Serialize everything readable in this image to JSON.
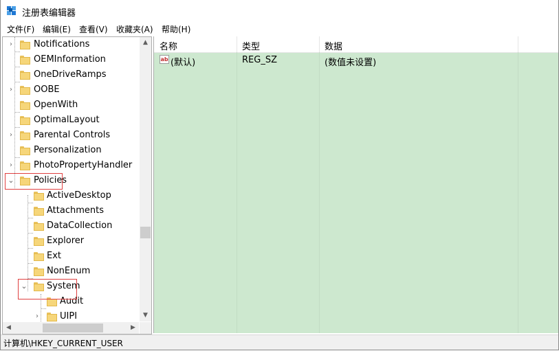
{
  "window": {
    "title": "注册表编辑器",
    "accent": "#1e78d4"
  },
  "menu": [
    {
      "label": "文件(F)"
    },
    {
      "label": "编辑(E)"
    },
    {
      "label": "查看(V)"
    },
    {
      "label": "收藏夹(A)"
    },
    {
      "label": "帮助(H)"
    }
  ],
  "tree": {
    "nodes": [
      {
        "label": "Notifications",
        "expander": "collapsed"
      },
      {
        "label": "OEMInformation",
        "expander": "none"
      },
      {
        "label": "OneDriveRamps",
        "expander": "none"
      },
      {
        "label": "OOBE",
        "expander": "collapsed"
      },
      {
        "label": "OpenWith",
        "expander": "none"
      },
      {
        "label": "OptimalLayout",
        "expander": "none"
      },
      {
        "label": "Parental Controls",
        "expander": "collapsed"
      },
      {
        "label": "Personalization",
        "expander": "none"
      },
      {
        "label": "PhotoPropertyHandler",
        "expander": "collapsed"
      },
      {
        "label": "Policies",
        "expander": "expanded",
        "highlighted": true
      },
      {
        "label": "ActiveDesktop",
        "expander": "none"
      },
      {
        "label": "Attachments",
        "expander": "none"
      },
      {
        "label": "DataCollection",
        "expander": "none"
      },
      {
        "label": "Explorer",
        "expander": "none"
      },
      {
        "label": "Ext",
        "expander": "none"
      },
      {
        "label": "NonEnum",
        "expander": "none"
      },
      {
        "label": "System",
        "expander": "expanded",
        "highlighted": true
      },
      {
        "label": "Audit",
        "expander": "none"
      },
      {
        "label": "UIPI",
        "expander": "collapsed"
      }
    ],
    "highlight_color": "#e04040"
  },
  "values": {
    "columns": [
      "名称",
      "类型",
      "数据"
    ],
    "rows": [
      {
        "name": "(默认)",
        "type": "REG_SZ",
        "data": "(数值未设置)",
        "icon": "ab-string-icon"
      }
    ],
    "background": "#cde8cf"
  },
  "status": {
    "path": "计算机\\HKEY_CURRENT_USER"
  }
}
